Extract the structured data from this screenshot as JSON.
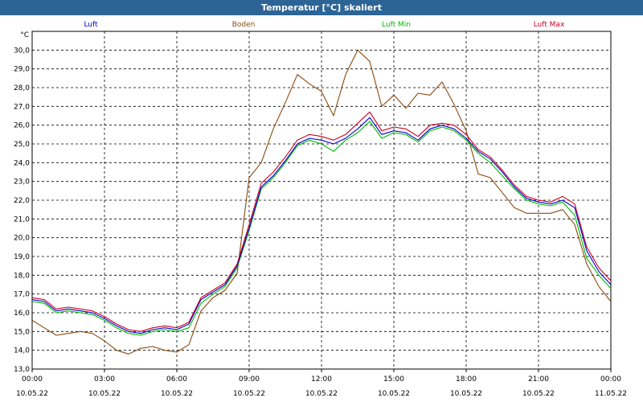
{
  "window": {
    "title": "Temperatur [°C] skaliert"
  },
  "colors": {
    "titlebar": "#2c6496",
    "luft": "#0000cc",
    "boden": "#8b4a10",
    "luftMin": "#00bb00",
    "luftMax": "#cc0022",
    "grid": "#000000"
  },
  "chart_data": {
    "type": "line",
    "title": "Temperatur [°C] skaliert",
    "ylabel": "°C",
    "ylim": [
      13.0,
      31.0
    ],
    "yticks": [
      "14,0",
      "15,0",
      "16,0",
      "17,0",
      "18,0",
      "19,0",
      "20,0",
      "21,0",
      "22,0",
      "23,0",
      "24,0",
      "25,0",
      "26,0",
      "27,0",
      "28,0",
      "29,0",
      "30,0"
    ],
    "ytick_values": [
      14,
      15,
      16,
      17,
      18,
      19,
      20,
      21,
      22,
      23,
      24,
      25,
      26,
      27,
      28,
      29,
      30
    ],
    "ybottom_label": "13,0",
    "xlim": [
      0,
      24
    ],
    "xticks": [
      {
        "time": "00:00",
        "date": "10.05.22",
        "h": 0
      },
      {
        "time": "03:00",
        "date": "10.05.22",
        "h": 3
      },
      {
        "time": "06:00",
        "date": "10.05.22",
        "h": 6
      },
      {
        "time": "09:00",
        "date": "10.05.22",
        "h": 9
      },
      {
        "time": "12:00",
        "date": "10.05.22",
        "h": 12
      },
      {
        "time": "15:00",
        "date": "10.05.22",
        "h": 15
      },
      {
        "time": "18:00",
        "date": "10.05.22",
        "h": 18
      },
      {
        "time": "21:00",
        "date": "10.05.22",
        "h": 21
      },
      {
        "time": "00:00",
        "date": "11.05.22",
        "h": 24
      }
    ],
    "grid": true,
    "legend_position": "top",
    "series": [
      {
        "name": "Luft",
        "color": "#0000cc",
        "points": [
          [
            0,
            16.7
          ],
          [
            0.5,
            16.6
          ],
          [
            1,
            16.1
          ],
          [
            1.5,
            16.2
          ],
          [
            2,
            16.1
          ],
          [
            2.5,
            16.0
          ],
          [
            3,
            15.7
          ],
          [
            3.5,
            15.3
          ],
          [
            4,
            15.0
          ],
          [
            4.5,
            14.9
          ],
          [
            5,
            15.1
          ],
          [
            5.5,
            15.2
          ],
          [
            6,
            15.1
          ],
          [
            6.5,
            15.4
          ],
          [
            7,
            16.7
          ],
          [
            7.5,
            17.1
          ],
          [
            8,
            17.5
          ],
          [
            8.5,
            18.5
          ],
          [
            9,
            20.5
          ],
          [
            9.5,
            22.7
          ],
          [
            10,
            23.3
          ],
          [
            10.5,
            24.1
          ],
          [
            11,
            25.0
          ],
          [
            11.5,
            25.3
          ],
          [
            12,
            25.2
          ],
          [
            12.5,
            25.0
          ],
          [
            13,
            25.3
          ],
          [
            13.5,
            25.8
          ],
          [
            14,
            26.4
          ],
          [
            14.5,
            25.5
          ],
          [
            15,
            25.7
          ],
          [
            15.5,
            25.6
          ],
          [
            16,
            25.2
          ],
          [
            16.5,
            25.8
          ],
          [
            17,
            26.0
          ],
          [
            17.5,
            25.8
          ],
          [
            18,
            25.3
          ],
          [
            18.5,
            24.6
          ],
          [
            19,
            24.2
          ],
          [
            19.5,
            23.5
          ],
          [
            20,
            22.7
          ],
          [
            20.5,
            22.1
          ],
          [
            21,
            21.9
          ],
          [
            21.5,
            21.8
          ],
          [
            22,
            22.0
          ],
          [
            22.5,
            21.6
          ],
          [
            23,
            19.3
          ],
          [
            23.5,
            18.2
          ],
          [
            24,
            17.5
          ]
        ]
      },
      {
        "name": "Boden",
        "color": "#8b4a10",
        "points": [
          [
            0,
            15.6
          ],
          [
            0.5,
            15.2
          ],
          [
            1,
            14.8
          ],
          [
            1.5,
            14.9
          ],
          [
            2,
            15.0
          ],
          [
            2.5,
            14.9
          ],
          [
            3,
            14.5
          ],
          [
            3.5,
            14.0
          ],
          [
            4,
            13.8
          ],
          [
            4.5,
            14.1
          ],
          [
            5,
            14.2
          ],
          [
            5.5,
            14.0
          ],
          [
            6,
            13.9
          ],
          [
            6.5,
            14.3
          ],
          [
            7,
            16.1
          ],
          [
            7.5,
            16.8
          ],
          [
            8,
            17.2
          ],
          [
            8.5,
            18.1
          ],
          [
            9,
            23.2
          ],
          [
            9.5,
            24.0
          ],
          [
            10,
            25.8
          ],
          [
            10.5,
            27.2
          ],
          [
            11,
            28.7
          ],
          [
            11.5,
            28.2
          ],
          [
            12,
            27.8
          ],
          [
            12.5,
            26.5
          ],
          [
            13,
            28.7
          ],
          [
            13.5,
            30.0
          ],
          [
            14,
            29.4
          ],
          [
            14.5,
            27.0
          ],
          [
            15,
            27.6
          ],
          [
            15.5,
            26.9
          ],
          [
            16,
            27.7
          ],
          [
            16.5,
            27.6
          ],
          [
            17,
            28.3
          ],
          [
            17.5,
            27.1
          ],
          [
            18,
            25.7
          ],
          [
            18.5,
            23.4
          ],
          [
            19,
            23.2
          ],
          [
            19.5,
            22.4
          ],
          [
            20,
            21.6
          ],
          [
            20.5,
            21.3
          ],
          [
            21,
            21.3
          ],
          [
            21.5,
            21.3
          ],
          [
            22,
            21.5
          ],
          [
            22.5,
            20.7
          ],
          [
            23,
            18.6
          ],
          [
            23.5,
            17.4
          ],
          [
            24,
            16.6
          ]
        ]
      },
      {
        "name": "Luft Min",
        "color": "#00bb00",
        "points": [
          [
            0,
            16.6
          ],
          [
            0.5,
            16.5
          ],
          [
            1,
            16.0
          ],
          [
            1.5,
            16.1
          ],
          [
            2,
            16.0
          ],
          [
            2.5,
            15.9
          ],
          [
            3,
            15.6
          ],
          [
            3.5,
            15.2
          ],
          [
            4,
            14.9
          ],
          [
            4.5,
            14.8
          ],
          [
            5,
            15.0
          ],
          [
            5.5,
            15.1
          ],
          [
            6,
            15.0
          ],
          [
            6.5,
            15.2
          ],
          [
            7,
            16.5
          ],
          [
            7.5,
            17.0
          ],
          [
            8,
            17.4
          ],
          [
            8.5,
            18.4
          ],
          [
            9,
            20.4
          ],
          [
            9.5,
            22.6
          ],
          [
            10,
            23.2
          ],
          [
            10.5,
            24.0
          ],
          [
            11,
            24.9
          ],
          [
            11.5,
            25.2
          ],
          [
            12,
            25.0
          ],
          [
            12.5,
            24.6
          ],
          [
            13,
            25.2
          ],
          [
            13.5,
            25.6
          ],
          [
            14,
            26.2
          ],
          [
            14.5,
            25.3
          ],
          [
            15,
            25.6
          ],
          [
            15.5,
            25.5
          ],
          [
            16,
            25.1
          ],
          [
            16.5,
            25.7
          ],
          [
            17,
            25.9
          ],
          [
            17.5,
            25.7
          ],
          [
            18,
            25.2
          ],
          [
            18.5,
            24.5
          ],
          [
            19,
            24.0
          ],
          [
            19.5,
            23.3
          ],
          [
            20,
            22.6
          ],
          [
            20.5,
            22.0
          ],
          [
            21,
            21.8
          ],
          [
            21.5,
            21.7
          ],
          [
            22,
            21.9
          ],
          [
            22.5,
            21.2
          ],
          [
            23,
            18.9
          ],
          [
            23.5,
            18.0
          ],
          [
            24,
            17.3
          ]
        ]
      },
      {
        "name": "Luft Max",
        "color": "#cc0022",
        "points": [
          [
            0,
            16.8
          ],
          [
            0.5,
            16.7
          ],
          [
            1,
            16.2
          ],
          [
            1.5,
            16.3
          ],
          [
            2,
            16.2
          ],
          [
            2.5,
            16.1
          ],
          [
            3,
            15.8
          ],
          [
            3.5,
            15.4
          ],
          [
            4,
            15.1
          ],
          [
            4.5,
            15.0
          ],
          [
            5,
            15.2
          ],
          [
            5.5,
            15.3
          ],
          [
            6,
            15.2
          ],
          [
            6.5,
            15.5
          ],
          [
            7,
            16.8
          ],
          [
            7.5,
            17.2
          ],
          [
            8,
            17.6
          ],
          [
            8.5,
            18.6
          ],
          [
            9,
            20.7
          ],
          [
            9.5,
            22.9
          ],
          [
            10,
            23.5
          ],
          [
            10.5,
            24.3
          ],
          [
            11,
            25.2
          ],
          [
            11.5,
            25.5
          ],
          [
            12,
            25.4
          ],
          [
            12.5,
            25.2
          ],
          [
            13,
            25.5
          ],
          [
            13.5,
            26.1
          ],
          [
            14,
            26.7
          ],
          [
            14.5,
            25.7
          ],
          [
            15,
            25.9
          ],
          [
            15.5,
            25.8
          ],
          [
            16,
            25.4
          ],
          [
            16.5,
            26.0
          ],
          [
            17,
            26.1
          ],
          [
            17.5,
            26.0
          ],
          [
            18,
            25.5
          ],
          [
            18.5,
            24.7
          ],
          [
            19,
            24.3
          ],
          [
            19.5,
            23.6
          ],
          [
            20,
            22.8
          ],
          [
            20.5,
            22.2
          ],
          [
            21,
            22.0
          ],
          [
            21.5,
            21.9
          ],
          [
            22,
            22.2
          ],
          [
            22.5,
            21.8
          ],
          [
            23,
            19.5
          ],
          [
            23.5,
            18.4
          ],
          [
            24,
            17.7
          ]
        ]
      }
    ]
  }
}
